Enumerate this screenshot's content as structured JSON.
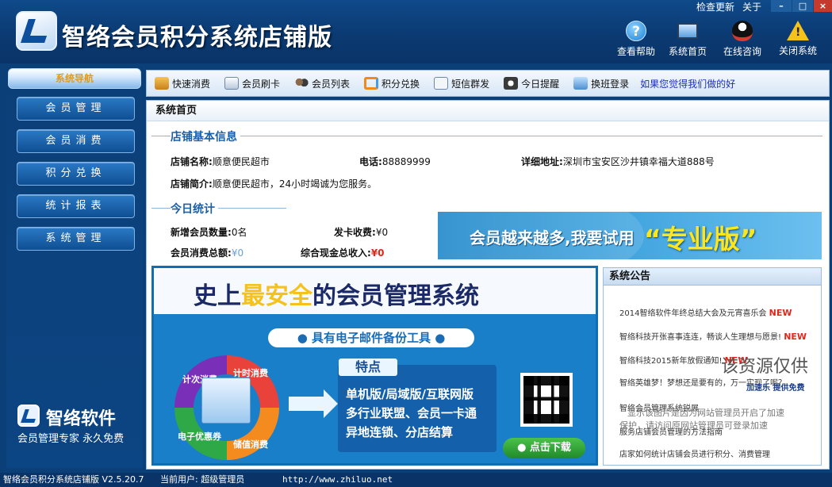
{
  "header": {
    "title": "智络会员积分系统店铺版",
    "top_links": [
      "检查更新",
      "关于"
    ],
    "window_controls": {
      "min": "–",
      "max": "□",
      "close": "×"
    },
    "buttons": [
      {
        "label": "查看帮助",
        "icon": "help-icon"
      },
      {
        "label": "系统首页",
        "icon": "monitor-icon"
      },
      {
        "label": "在线咨询",
        "icon": "qq-icon"
      },
      {
        "label": "关闭系统",
        "icon": "warning-icon"
      }
    ]
  },
  "sidebar": {
    "heading": "系统导航",
    "items": [
      "会员管理",
      "会员消费",
      "积分兑换",
      "统计报表",
      "系统管理"
    ],
    "brand_name": "智络软件",
    "brand_slogan": "会员管理专家 永久免费"
  },
  "toolbar": {
    "items": [
      {
        "label": "快速消费",
        "icon": "cart-icon"
      },
      {
        "label": "会员刷卡",
        "icon": "card-icon"
      },
      {
        "label": "会员列表",
        "icon": "users-icon"
      },
      {
        "label": "积分兑换",
        "icon": "exchange-icon"
      },
      {
        "label": "短信群发",
        "icon": "mail-icon"
      },
      {
        "label": "今日提醒",
        "icon": "clock-icon"
      },
      {
        "label": "换班登录",
        "icon": "shift-icon"
      }
    ],
    "link": "如果您觉得我们做的好"
  },
  "main": {
    "tab_title": "系统首页",
    "store_info": {
      "section_title": "店铺基本信息",
      "name_label": "店铺名称:",
      "name_value": "顺意便民超市",
      "phone_label": "电话:",
      "phone_value": "88889999",
      "address_label": "详细地址:",
      "address_value": "深圳市宝安区沙井镇幸福大道888号",
      "intro_label": "店铺简介:",
      "intro_value": "顺意便民超市，24小时竭诚为您服务。"
    },
    "today_stats": {
      "section_title": "今日统计",
      "new_members_label": "新增会员数量:",
      "new_members_value": "0名",
      "card_fee_label": "发卡收费:",
      "card_fee_value": "¥0",
      "consume_total_label": "会员消费总额:",
      "consume_total_value": "¥0",
      "cash_total_label": "综合现金总收入:",
      "cash_total_value": "¥0"
    },
    "promo": {
      "text": "会员越来越多,我要试用",
      "highlight": "“专业版”"
    },
    "banner": {
      "headline_pre": "史上",
      "headline_hl": "最安全",
      "headline_post": "的会员管理系统",
      "tool_line": "● 具有电子邮件备份工具 ●",
      "cycle_labels": [
        "计次消费",
        "计时消费",
        "储值消费",
        "电子优惠券"
      ],
      "features_title": "特点",
      "features": [
        "单机版/局域版/互联网版",
        "多行业联盟、会员一卡通",
        "异地连锁、分店结算"
      ],
      "download_label": "● 点击下载"
    },
    "notice": {
      "title": "系统公告",
      "items": [
        {
          "text": "2014智络软件年终总结大会及元宵喜乐会",
          "new": "NEW"
        },
        {
          "text": "智络科技开张喜事连连，畅谈人生理想与愿景!",
          "new": "NEW"
        },
        {
          "text": "智络科技2015新年放假通知!",
          "new": "NEW"
        },
        {
          "text": "智络英雄梦！梦想还是要有的，万一实现了呢？",
          "new": ""
        },
        {
          "text": "智络会员管理系统锐展",
          "new": ""
        },
        {
          "text": "服务店铺会员管理的方法指南",
          "new": ""
        },
        {
          "text": "店家如何统计店铺会员进行积分、消费管理",
          "new": ""
        }
      ],
      "watermark": {
        "big": "该资源仅供",
        "speed": "加速乐  提供免费",
        "line1": "显示该图片是因为网站管理员开启了加速",
        "line2": "保护，请访问原网站管理员可登录加速"
      }
    }
  },
  "status_bar": {
    "app_version": "智络会员积分系统店铺版 V2.5.20.7",
    "current_user": "当前用户: 超级管理员",
    "url": "http://www.zhiluo.net"
  },
  "colors": {
    "primary": "#0b3f78",
    "accent": "#1a7fc9",
    "highlight": "#f4c21a",
    "alert": "#e3261b"
  }
}
